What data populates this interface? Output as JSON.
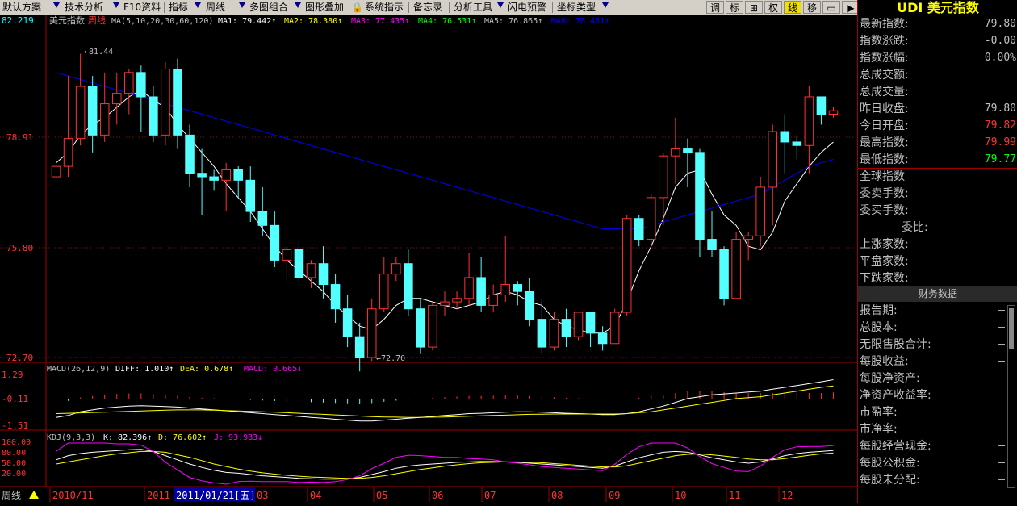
{
  "toolbar": {
    "items": [
      "默认方案",
      "技术分析",
      "F10资料",
      "指标",
      "周线",
      "多图组合",
      "图形叠加",
      "系统指示",
      "备忘录",
      "分析工具",
      "闪电预警",
      "坐标类型"
    ],
    "right_buttons": [
      "调",
      "标",
      "⊞",
      "权",
      "线",
      "移",
      "▭",
      "▶"
    ]
  },
  "chart_header": {
    "name": "美元指数",
    "period": "周线",
    "ma_params": "MA(5,10,20,30,60,120)",
    "ma1": "MA1: 79.442↑",
    "ma2": "MA2: 78.380↑",
    "ma3": "MA3: 77.435↑",
    "ma4": "MA4: 76.531↑",
    "ma5": "MA5: 76.865↑",
    "ma6": "MA6: 78.481↑"
  },
  "price_axis": {
    "top_label": "82.219",
    "labels": [
      "78.91",
      "75.80",
      "72.70"
    ]
  },
  "annotations": {
    "high": "81.44",
    "low": "72.70"
  },
  "macd": {
    "title": "MACD(26,12,9)",
    "diff": "DIFF: 1.010↑",
    "dea": "DEA: 0.678↑",
    "macd": "MACD: 0.665↓",
    "axis": [
      "1.29",
      "-0.11",
      "-1.51"
    ]
  },
  "kdj": {
    "title": "KDJ(9,3,3)",
    "k": "K: 82.396↑",
    "d": "D: 76.602↑",
    "j": "J: 93.983↓",
    "axis": [
      "100.00",
      "80.00",
      "50.00",
      "20.00"
    ]
  },
  "time_axis": {
    "period_badge": "周线",
    "labels": [
      "2010/11",
      "2011",
      "03",
      "04",
      "05",
      "06",
      "07",
      "08",
      "09",
      "10",
      "11",
      "12"
    ],
    "cursor": "2011/01/21[五]"
  },
  "colors": {
    "up": "#ff3232",
    "down": "#54ffff",
    "ma1": "#ffffff",
    "ma2": "#ffff00",
    "ma3": "#ff00ff",
    "ma4": "#00ff00",
    "ma5": "#c0c0c0",
    "ma6": "#0000ff",
    "axis": "#a00000"
  },
  "right_panel": {
    "title": "UDI 美元指数",
    "quote_rows": [
      {
        "label": "最新指数:",
        "value": "79.80",
        "color": "#c0c0c0"
      },
      {
        "label": "指数涨跌:",
        "value": "-0.00",
        "color": "#c0c0c0"
      },
      {
        "label": "指数涨幅:",
        "value": "0.00%",
        "color": "#c0c0c0"
      },
      {
        "label": "总成交额:",
        "value": "",
        "color": "#c0c0c0"
      },
      {
        "label": "总成交量:",
        "value": "",
        "color": "#c0c0c0"
      },
      {
        "label": "昨日收盘:",
        "value": "79.80",
        "color": "#c0c0c0"
      },
      {
        "label": "今日开盘:",
        "value": "79.82",
        "color": "#ff3232"
      },
      {
        "label": "最高指数:",
        "value": "79.99",
        "color": "#ff3232"
      },
      {
        "label": "最低指数:",
        "value": "79.77",
        "color": "#00ff00"
      }
    ],
    "global_rows": [
      "全球指数",
      "委卖手数:",
      "委买手数:",
      "委比:",
      "上涨家数:",
      "平盘家数:",
      "下跌家数:"
    ],
    "finance_header": "财务数据",
    "finance_rows": [
      {
        "label": "报告期:",
        "value": "—"
      },
      {
        "label": "总股本:",
        "value": "—"
      },
      {
        "label": "无限售股合计:",
        "value": "—"
      },
      {
        "label": "每股收益:",
        "value": "—"
      },
      {
        "label": "每股净资产:",
        "value": "—"
      },
      {
        "label": "净资产收益率:",
        "value": "—"
      },
      {
        "label": "市盈率:",
        "value": "—"
      },
      {
        "label": "市净率:",
        "value": "—"
      },
      {
        "label": "每股经营现金:",
        "value": "—"
      },
      {
        "label": "每股公积金:",
        "value": "—"
      },
      {
        "label": "每股未分配:",
        "value": "—"
      }
    ]
  },
  "chart_data": [
    {
      "type": "candlestick",
      "title": "美元指数 周线",
      "ylim": [
        72.7,
        82.219
      ],
      "candles": [
        [
          77.9,
          78.8,
          78.2,
          77.5
        ],
        [
          78.2,
          80.8,
          79.0,
          77.9
        ],
        [
          79.0,
          81.44,
          80.5,
          78.8
        ],
        [
          80.5,
          80.8,
          79.1,
          78.6
        ],
        [
          79.1,
          80.9,
          80.0,
          78.9
        ],
        [
          80.0,
          80.9,
          80.3,
          79.4
        ],
        [
          80.3,
          81.0,
          80.9,
          79.7
        ],
        [
          80.9,
          81.1,
          80.2,
          79.2
        ],
        [
          80.2,
          80.5,
          79.1,
          78.9
        ],
        [
          79.1,
          81.2,
          81.0,
          78.8
        ],
        [
          81.0,
          81.3,
          79.1,
          78.7
        ],
        [
          79.1,
          79.4,
          78.0,
          77.6
        ],
        [
          78.0,
          78.7,
          77.9,
          76.8
        ],
        [
          77.9,
          78.1,
          77.8,
          77.5
        ],
        [
          77.8,
          78.3,
          78.1,
          76.9
        ],
        [
          78.1,
          78.2,
          77.8,
          77.3
        ],
        [
          77.8,
          78.2,
          76.9,
          76.6
        ],
        [
          76.9,
          77.6,
          76.5,
          76.2
        ],
        [
          76.5,
          76.9,
          75.5,
          75.3
        ],
        [
          75.5,
          75.9,
          75.8,
          74.9
        ],
        [
          75.8,
          76.1,
          75.0,
          74.8
        ],
        [
          75.0,
          75.5,
          75.4,
          74.7
        ],
        [
          75.4,
          75.9,
          74.8,
          74.4
        ],
        [
          74.8,
          75.1,
          74.1,
          73.7
        ],
        [
          74.1,
          74.5,
          73.3,
          73.0
        ],
        [
          73.3,
          73.7,
          72.7,
          72.3
        ],
        [
          72.7,
          74.4,
          74.1,
          72.6
        ],
        [
          74.1,
          75.6,
          75.1,
          74.0
        ],
        [
          75.1,
          75.6,
          75.4,
          74.9
        ],
        [
          75.4,
          75.8,
          74.1,
          73.9
        ],
        [
          74.1,
          74.4,
          73.0,
          72.8
        ],
        [
          73.0,
          74.3,
          74.2,
          72.9
        ],
        [
          74.2,
          74.6,
          74.3,
          73.9
        ],
        [
          74.3,
          74.6,
          74.4,
          74.1
        ],
        [
          74.4,
          75.7,
          75.0,
          74.2
        ],
        [
          75.0,
          75.6,
          74.2,
          74.0
        ],
        [
          74.2,
          74.8,
          74.5,
          74.0
        ],
        [
          74.5,
          76.2,
          74.8,
          74.3
        ],
        [
          74.8,
          74.9,
          74.6,
          74.2
        ],
        [
          74.6,
          75.0,
          73.8,
          73.6
        ],
        [
          73.8,
          74.4,
          73.0,
          72.8
        ],
        [
          73.0,
          74.0,
          73.8,
          72.9
        ],
        [
          73.8,
          74.1,
          73.3,
          73.0
        ],
        [
          73.3,
          74.0,
          74.0,
          73.2
        ],
        [
          74.0,
          74.0,
          73.4,
          73.0
        ],
        [
          73.4,
          73.6,
          73.1,
          72.9
        ],
        [
          73.1,
          74.1,
          74.0,
          73.1
        ],
        [
          74.0,
          76.8,
          76.7,
          73.9
        ],
        [
          76.7,
          76.8,
          76.1,
          75.9
        ],
        [
          76.1,
          77.4,
          77.3,
          75.9
        ],
        [
          77.3,
          78.6,
          78.5,
          76.5
        ],
        [
          78.5,
          79.6,
          78.7,
          77.7
        ],
        [
          78.7,
          79.0,
          78.6,
          77.6
        ],
        [
          78.6,
          78.7,
          76.1,
          75.6
        ],
        [
          76.1,
          76.9,
          75.8,
          75.6
        ],
        [
          75.8,
          75.9,
          74.4,
          74.2
        ],
        [
          74.4,
          76.3,
          76.1,
          74.7
        ],
        [
          76.1,
          76.3,
          76.2,
          75.5
        ],
        [
          76.2,
          77.9,
          77.6,
          75.9
        ],
        [
          77.6,
          79.4,
          79.2,
          76.5
        ],
        [
          79.2,
          79.7,
          78.9,
          78.0
        ],
        [
          78.9,
          79.1,
          78.8,
          78.4
        ],
        [
          78.8,
          80.5,
          80.2,
          78.0
        ],
        [
          80.2,
          80.2,
          79.7,
          79.4
        ],
        [
          79.7,
          79.9,
          79.8,
          79.6
        ]
      ],
      "series": [
        {
          "name": "MA1",
          "values": [
            78.3,
            78.6,
            79.1,
            79.4,
            79.6,
            79.9,
            80.2,
            80.4,
            80.1,
            79.9,
            79.4,
            79.0,
            78.6,
            78.2,
            77.7,
            77.3,
            76.9,
            76.4,
            75.9,
            75.5,
            75.2,
            74.9,
            74.6,
            74.2,
            73.9,
            73.6,
            73.5,
            73.8,
            74.2,
            74.4,
            74.4,
            74.3,
            74.2,
            74.1,
            74.2,
            74.3,
            74.5,
            74.6,
            74.5,
            74.3,
            74.2,
            73.8,
            73.6,
            73.5,
            73.4,
            73.4,
            73.6,
            74.3,
            75.2,
            75.9,
            76.7,
            77.6,
            78.0,
            78.1,
            77.4,
            76.8,
            76.5,
            75.9,
            75.8,
            76.3,
            77.2,
            77.7,
            78.2,
            78.6,
            78.9
          ]
        },
        {
          "name": "MA2",
          "values": [
            80.9,
            80.8,
            80.7,
            80.6,
            80.5,
            80.4,
            80.3,
            80.2,
            80.1,
            80.0,
            79.9,
            79.8,
            79.7,
            79.6,
            79.5,
            79.4,
            79.3,
            79.2,
            79.1,
            79.0,
            78.9,
            78.8,
            78.7,
            78.6,
            78.5,
            78.4,
            78.3,
            78.2,
            78.1,
            78.0,
            77.9,
            77.8,
            77.7,
            77.6,
            77.5,
            77.4,
            77.3,
            77.2,
            77.1,
            77.0,
            76.9,
            76.8,
            76.7,
            76.6,
            76.5,
            76.4,
            76.4,
            76.4,
            76.4,
            76.5,
            76.6,
            76.7,
            76.8,
            76.9,
            77.0,
            77.1,
            77.2,
            77.3,
            77.4,
            77.6,
            77.8,
            78.0,
            78.2,
            78.3,
            78.4
          ]
        }
      ]
    },
    {
      "type": "bar",
      "title": "MACD(26,12,9)",
      "ylim": [
        -1.51,
        1.29
      ],
      "series": [
        {
          "name": "DIFF",
          "values": [
            -1.0,
            -0.9,
            -0.7,
            -0.6,
            -0.5,
            -0.45,
            -0.4,
            -0.38,
            -0.4,
            -0.42,
            -0.45,
            -0.5,
            -0.55,
            -0.6,
            -0.65,
            -0.7,
            -0.75,
            -0.8,
            -0.85,
            -0.9,
            -0.95,
            -1.0,
            -1.05,
            -1.1,
            -1.15,
            -1.2,
            -1.2,
            -1.15,
            -1.1,
            -1.05,
            -1.0,
            -0.95,
            -0.9,
            -0.85,
            -0.8,
            -0.78,
            -0.75,
            -0.72,
            -0.7,
            -0.7,
            -0.72,
            -0.75,
            -0.78,
            -0.8,
            -0.82,
            -0.85,
            -0.85,
            -0.8,
            -0.7,
            -0.55,
            -0.4,
            -0.2,
            0.0,
            0.1,
            0.2,
            0.25,
            0.3,
            0.35,
            0.4,
            0.5,
            0.6,
            0.7,
            0.8,
            0.9,
            1.01
          ]
        },
        {
          "name": "DEA",
          "values": [
            -0.8,
            -0.78,
            -0.76,
            -0.74,
            -0.72,
            -0.7,
            -0.68,
            -0.66,
            -0.64,
            -0.62,
            -0.6,
            -0.6,
            -0.6,
            -0.62,
            -0.64,
            -0.66,
            -0.68,
            -0.7,
            -0.72,
            -0.75,
            -0.78,
            -0.81,
            -0.84,
            -0.87,
            -0.9,
            -0.93,
            -0.96,
            -0.98,
            -0.99,
            -1.0,
            -1.0,
            -0.99,
            -0.98,
            -0.96,
            -0.94,
            -0.92,
            -0.9,
            -0.88,
            -0.86,
            -0.84,
            -0.83,
            -0.82,
            -0.82,
            -0.82,
            -0.82,
            -0.82,
            -0.82,
            -0.8,
            -0.75,
            -0.7,
            -0.6,
            -0.5,
            -0.4,
            -0.3,
            -0.2,
            -0.1,
            0.0,
            0.05,
            0.1,
            0.2,
            0.3,
            0.4,
            0.5,
            0.6,
            0.678
          ]
        }
      ]
    },
    {
      "type": "line",
      "title": "KDJ(9,3,3)",
      "ylim": [
        0,
        100
      ],
      "series": [
        {
          "name": "K",
          "values": [
            60,
            70,
            75,
            78,
            80,
            82,
            84,
            85,
            80,
            70,
            60,
            50,
            42,
            35,
            30,
            28,
            25,
            22,
            20,
            18,
            16,
            15,
            14,
            14,
            15,
            18,
            25,
            32,
            40,
            45,
            48,
            50,
            52,
            54,
            55,
            56,
            56,
            55,
            54,
            52,
            50,
            48,
            46,
            44,
            42,
            40,
            45,
            55,
            65,
            72,
            78,
            80,
            78,
            72,
            65,
            60,
            55,
            52,
            55,
            62,
            70,
            75,
            78,
            80,
            82.4
          ]
        },
        {
          "name": "D",
          "values": [
            50,
            55,
            60,
            65,
            70,
            74,
            77,
            80,
            80,
            78,
            72,
            66,
            58,
            50,
            44,
            38,
            33,
            29,
            26,
            23,
            21,
            19,
            18,
            17,
            16,
            16,
            18,
            22,
            27,
            32,
            37,
            41,
            45,
            48,
            51,
            53,
            54,
            55,
            55,
            54,
            53,
            51,
            49,
            47,
            45,
            43,
            43,
            46,
            52,
            58,
            64,
            70,
            73,
            74,
            72,
            69,
            66,
            62,
            60,
            60,
            63,
            67,
            71,
            74,
            76.6
          ]
        }
      ]
    }
  ]
}
